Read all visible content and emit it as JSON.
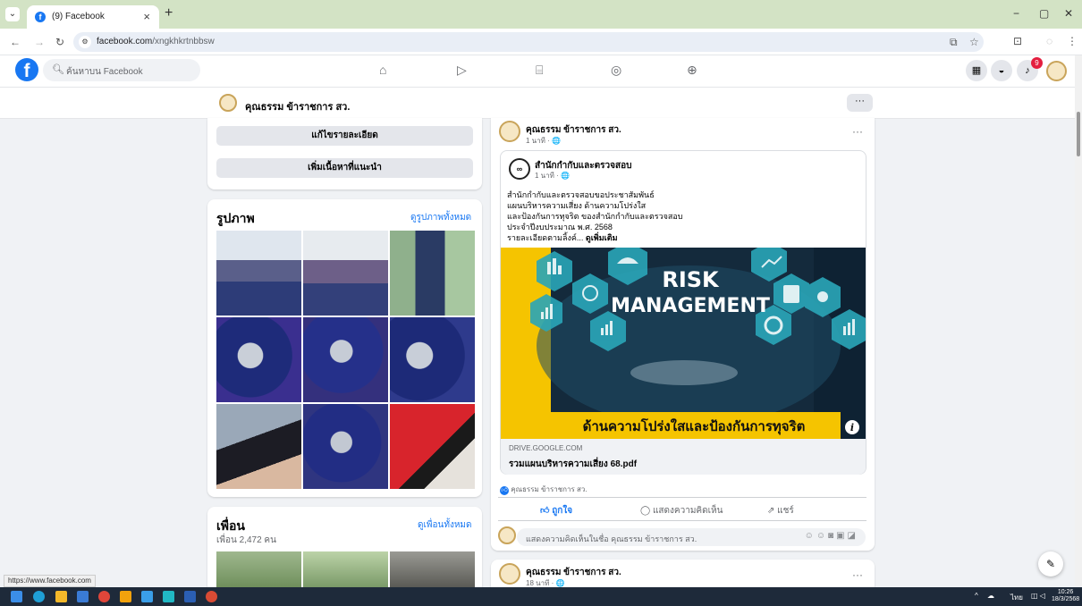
{
  "browser": {
    "tab_title": "(9) Facebook",
    "tab_close": "×",
    "new_tab": "+",
    "url_domain": "facebook.com",
    "url_path": "/xngkhkrtnbbsw",
    "window_buttons": [
      "−",
      "▢",
      "✕"
    ]
  },
  "facebook": {
    "logo": "f",
    "search_placeholder": "ค้นหาบน Facebook",
    "notification_count": "9"
  },
  "page_bar": {
    "name": "คุณธรรม ข้าราชการ สว.",
    "more": "···"
  },
  "left": {
    "edit_details": "แก้ไขรายละเอียด",
    "add_featured": "เพิ่มเนื้อหาที่แนะนำ",
    "photos_title": "รูปภาพ",
    "photos_see_all": "ดูรูปภาพทั้งหมด",
    "friends_title": "เพื่อน",
    "friends_count": "เพื่อน 2,472 คน",
    "friends_see_all": "ดูเพื่อนทั้งหมด"
  },
  "post": {
    "author": "คุณธรรม ข้าราชการ สว.",
    "meta": "1 นาที · 🌐",
    "more": "···",
    "shared_author": "สำนักกำกับและตรวจสอบ",
    "shared_meta": "1 นาที · 🌐",
    "shared_logo": "∞",
    "body": [
      "สำนักกำกับและตรวจสอบขอประชาสัมพันธ์",
      "แผนบริหารความเสี่ยง ด้านความโปร่งใส",
      "และป้องกันการทุจริต ของสำนักกำกับและตรวจสอบ",
      "ประจำปีงบประมาณ พ.ศ. 2568",
      "รายละเอียดตามลิ้งค์..."
    ],
    "see_more": "ดูเพิ่มเติม",
    "image": {
      "line1": "RISK",
      "line2": "MANAGEMENT",
      "banner": "ด้านความโปร่งใสและป้องกันการทุจริต"
    },
    "link_domain": "DRIVE.GOOGLE.COM",
    "link_title": "รวมแผนบริหารความเสี่ยง 68.pdf",
    "reaction_name": "คุณธรรม ข้าราชการ สว.",
    "like": "ถูกใจ",
    "comment": "แสดงความคิดเห็น",
    "share": "แชร์",
    "comment_placeholder": "แสดงความคิดเห็นในชื่อ คุณธรรม ข้าราชการ สว."
  },
  "post2": {
    "author": "คุณธรรม ข้าราชการ สว.",
    "meta": "18 นาที · 🌐",
    "more": "···"
  },
  "status_url": "https://www.facebook.com",
  "taskbar": {
    "lang": "ไทย",
    "time": "10:26",
    "date": "18/3/2568"
  },
  "colors": {
    "fb_blue": "#1877f2",
    "tab_strip": "#d3e3c5",
    "image_banner": "#f5c400"
  }
}
